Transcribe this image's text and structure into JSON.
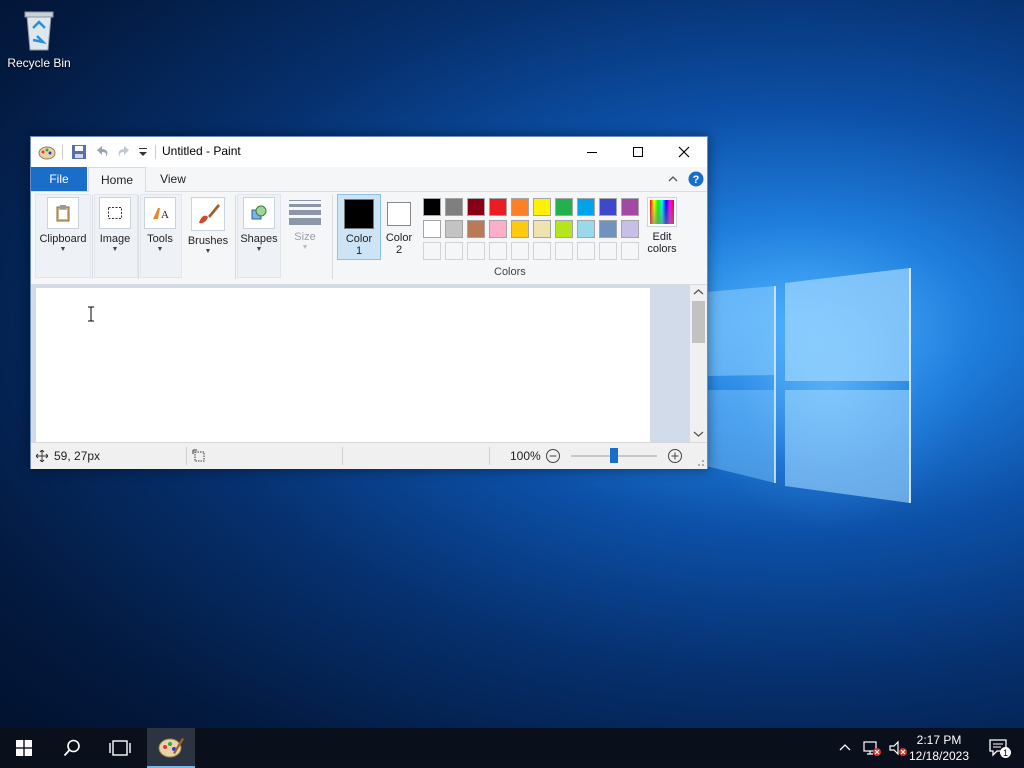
{
  "desktop": {
    "icons": [
      {
        "label": "Recycle Bin",
        "icon": "recycle-bin-icon"
      }
    ]
  },
  "window": {
    "title": "Untitled - Paint",
    "tabs": {
      "file": "File",
      "home": "Home",
      "view": "View"
    },
    "ribbon": {
      "clipboard": "Clipboard",
      "image": "Image",
      "tools": "Tools",
      "brushes": "Brushes",
      "shapes": "Shapes",
      "size": "Size",
      "color1_line1": "Color",
      "color1_line2": "1",
      "color2_line1": "Color",
      "color2_line2": "2",
      "colors_group": "Colors",
      "edit_colors_line1": "Edit",
      "edit_colors_line2": "colors"
    },
    "palette": {
      "row1": [
        "#000000",
        "#7f7f7f",
        "#880015",
        "#ed1c24",
        "#ff7f27",
        "#fff200",
        "#22b14c",
        "#00a2e8",
        "#3f48cc",
        "#a349a4"
      ],
      "row2": [
        "#ffffff",
        "#c3c3c3",
        "#b97a57",
        "#ffaec9",
        "#ffc90e",
        "#efe4b0",
        "#b5e61d",
        "#99d9ea",
        "#7092be",
        "#c8bfe7"
      ],
      "row3_empty": 10
    },
    "color1": "#000000",
    "color2": "#ffffff",
    "status": {
      "cursor_pos": "59, 27px",
      "zoom": "100%"
    }
  },
  "taskbar": {
    "time": "2:17 PM",
    "date": "12/18/2023",
    "notification_count": "1"
  }
}
